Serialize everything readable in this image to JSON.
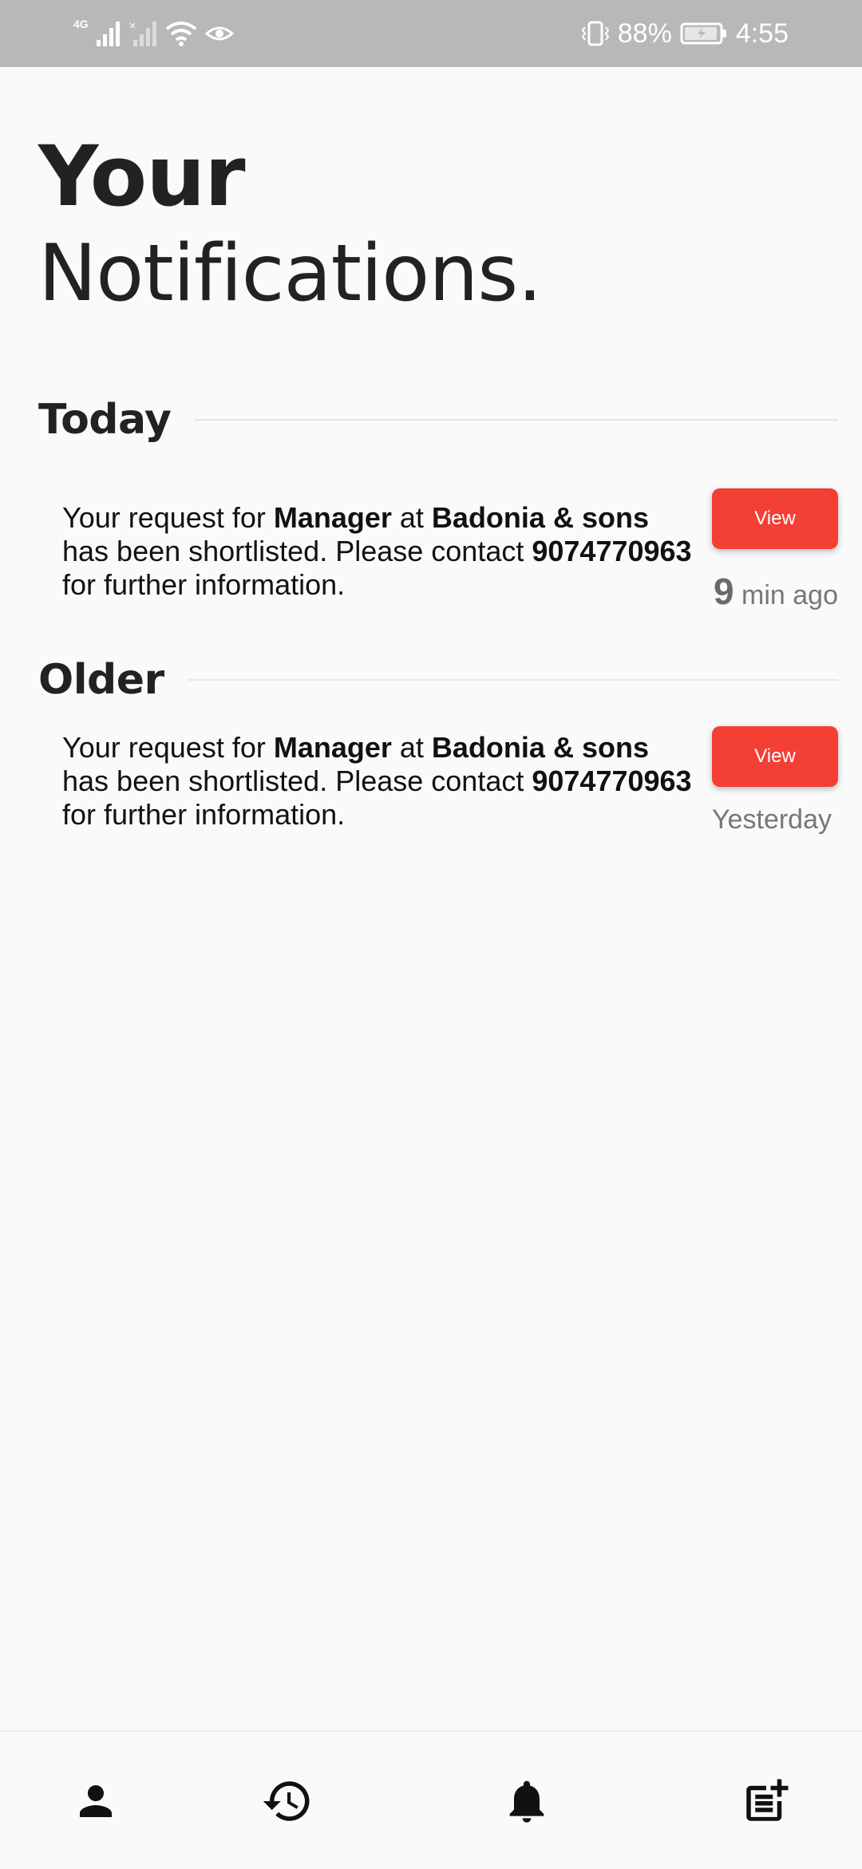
{
  "status_bar": {
    "network_label": "4G",
    "battery_percent": "88%",
    "time": "4:55"
  },
  "header": {
    "title_line1": "Your",
    "title_line2": "Notifications."
  },
  "sections": {
    "today": {
      "label": "Today",
      "items": [
        {
          "text_1": "Your request for ",
          "role": "Manager",
          "text_2": " at ",
          "company": "Badonia & sons",
          "text_3": " has been shortlisted. Please contact ",
          "phone": "9074770963",
          "text_4": " for further information.",
          "button_label": "View",
          "time_number": "9",
          "time_unit": " min ago"
        }
      ]
    },
    "older": {
      "label": "Older",
      "items": [
        {
          "text_1": "Your request for ",
          "role": "Manager",
          "text_2": " at ",
          "company": "Badonia & sons",
          "text_3": " has been shortlisted. Please contact ",
          "phone": "9074770963",
          "text_4": " for further information.",
          "button_label": "View",
          "time_label": "Yesterday"
        }
      ]
    }
  },
  "bottom_nav": {
    "items": [
      {
        "icon": "person-icon"
      },
      {
        "icon": "history-icon"
      },
      {
        "icon": "bell-icon"
      },
      {
        "icon": "post-add-icon"
      }
    ]
  },
  "colors": {
    "accent": "#f33f34",
    "background": "#fafafa",
    "status_bar": "#b8b8b8"
  }
}
